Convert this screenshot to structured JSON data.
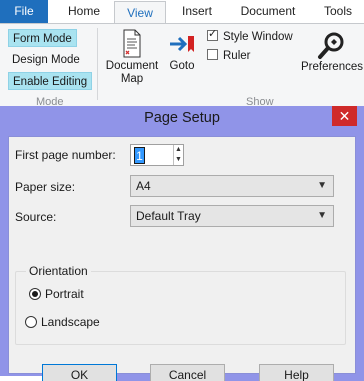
{
  "ribbon_tabs": {
    "file": "File",
    "home": "Home",
    "view": "View",
    "insert": "Insert",
    "document": "Document",
    "tools": "Tools"
  },
  "mode_group": {
    "form_mode": "Form Mode",
    "design_mode": "Design Mode",
    "enable_editing": "Enable Editing",
    "label": "Mode"
  },
  "show_group": {
    "document_map_line1": "Document",
    "document_map_line2": "Map",
    "goto": "Goto",
    "style_window": "Style Window",
    "style_window_checked": true,
    "ruler": "Ruler",
    "ruler_checked": false,
    "label": "Show"
  },
  "preferences": "Preferences",
  "dialog": {
    "title": "Page Setup",
    "first_page_label": "First page number:",
    "first_page_value": "1",
    "paper_size_label": "Paper size:",
    "paper_size_value": "A4",
    "source_label": "Source:",
    "source_value": "Default Tray",
    "orientation_label": "Orientation",
    "portrait": "Portrait",
    "landscape": "Landscape",
    "selected_orientation": "Portrait",
    "ok": "OK",
    "cancel": "Cancel",
    "help": "Help"
  },
  "colors": {
    "file_tab": "#1f6fbd",
    "active_mode": "#a9e3f0",
    "dialog_frame": "#9094e8",
    "close_button": "#cf2a2a"
  }
}
